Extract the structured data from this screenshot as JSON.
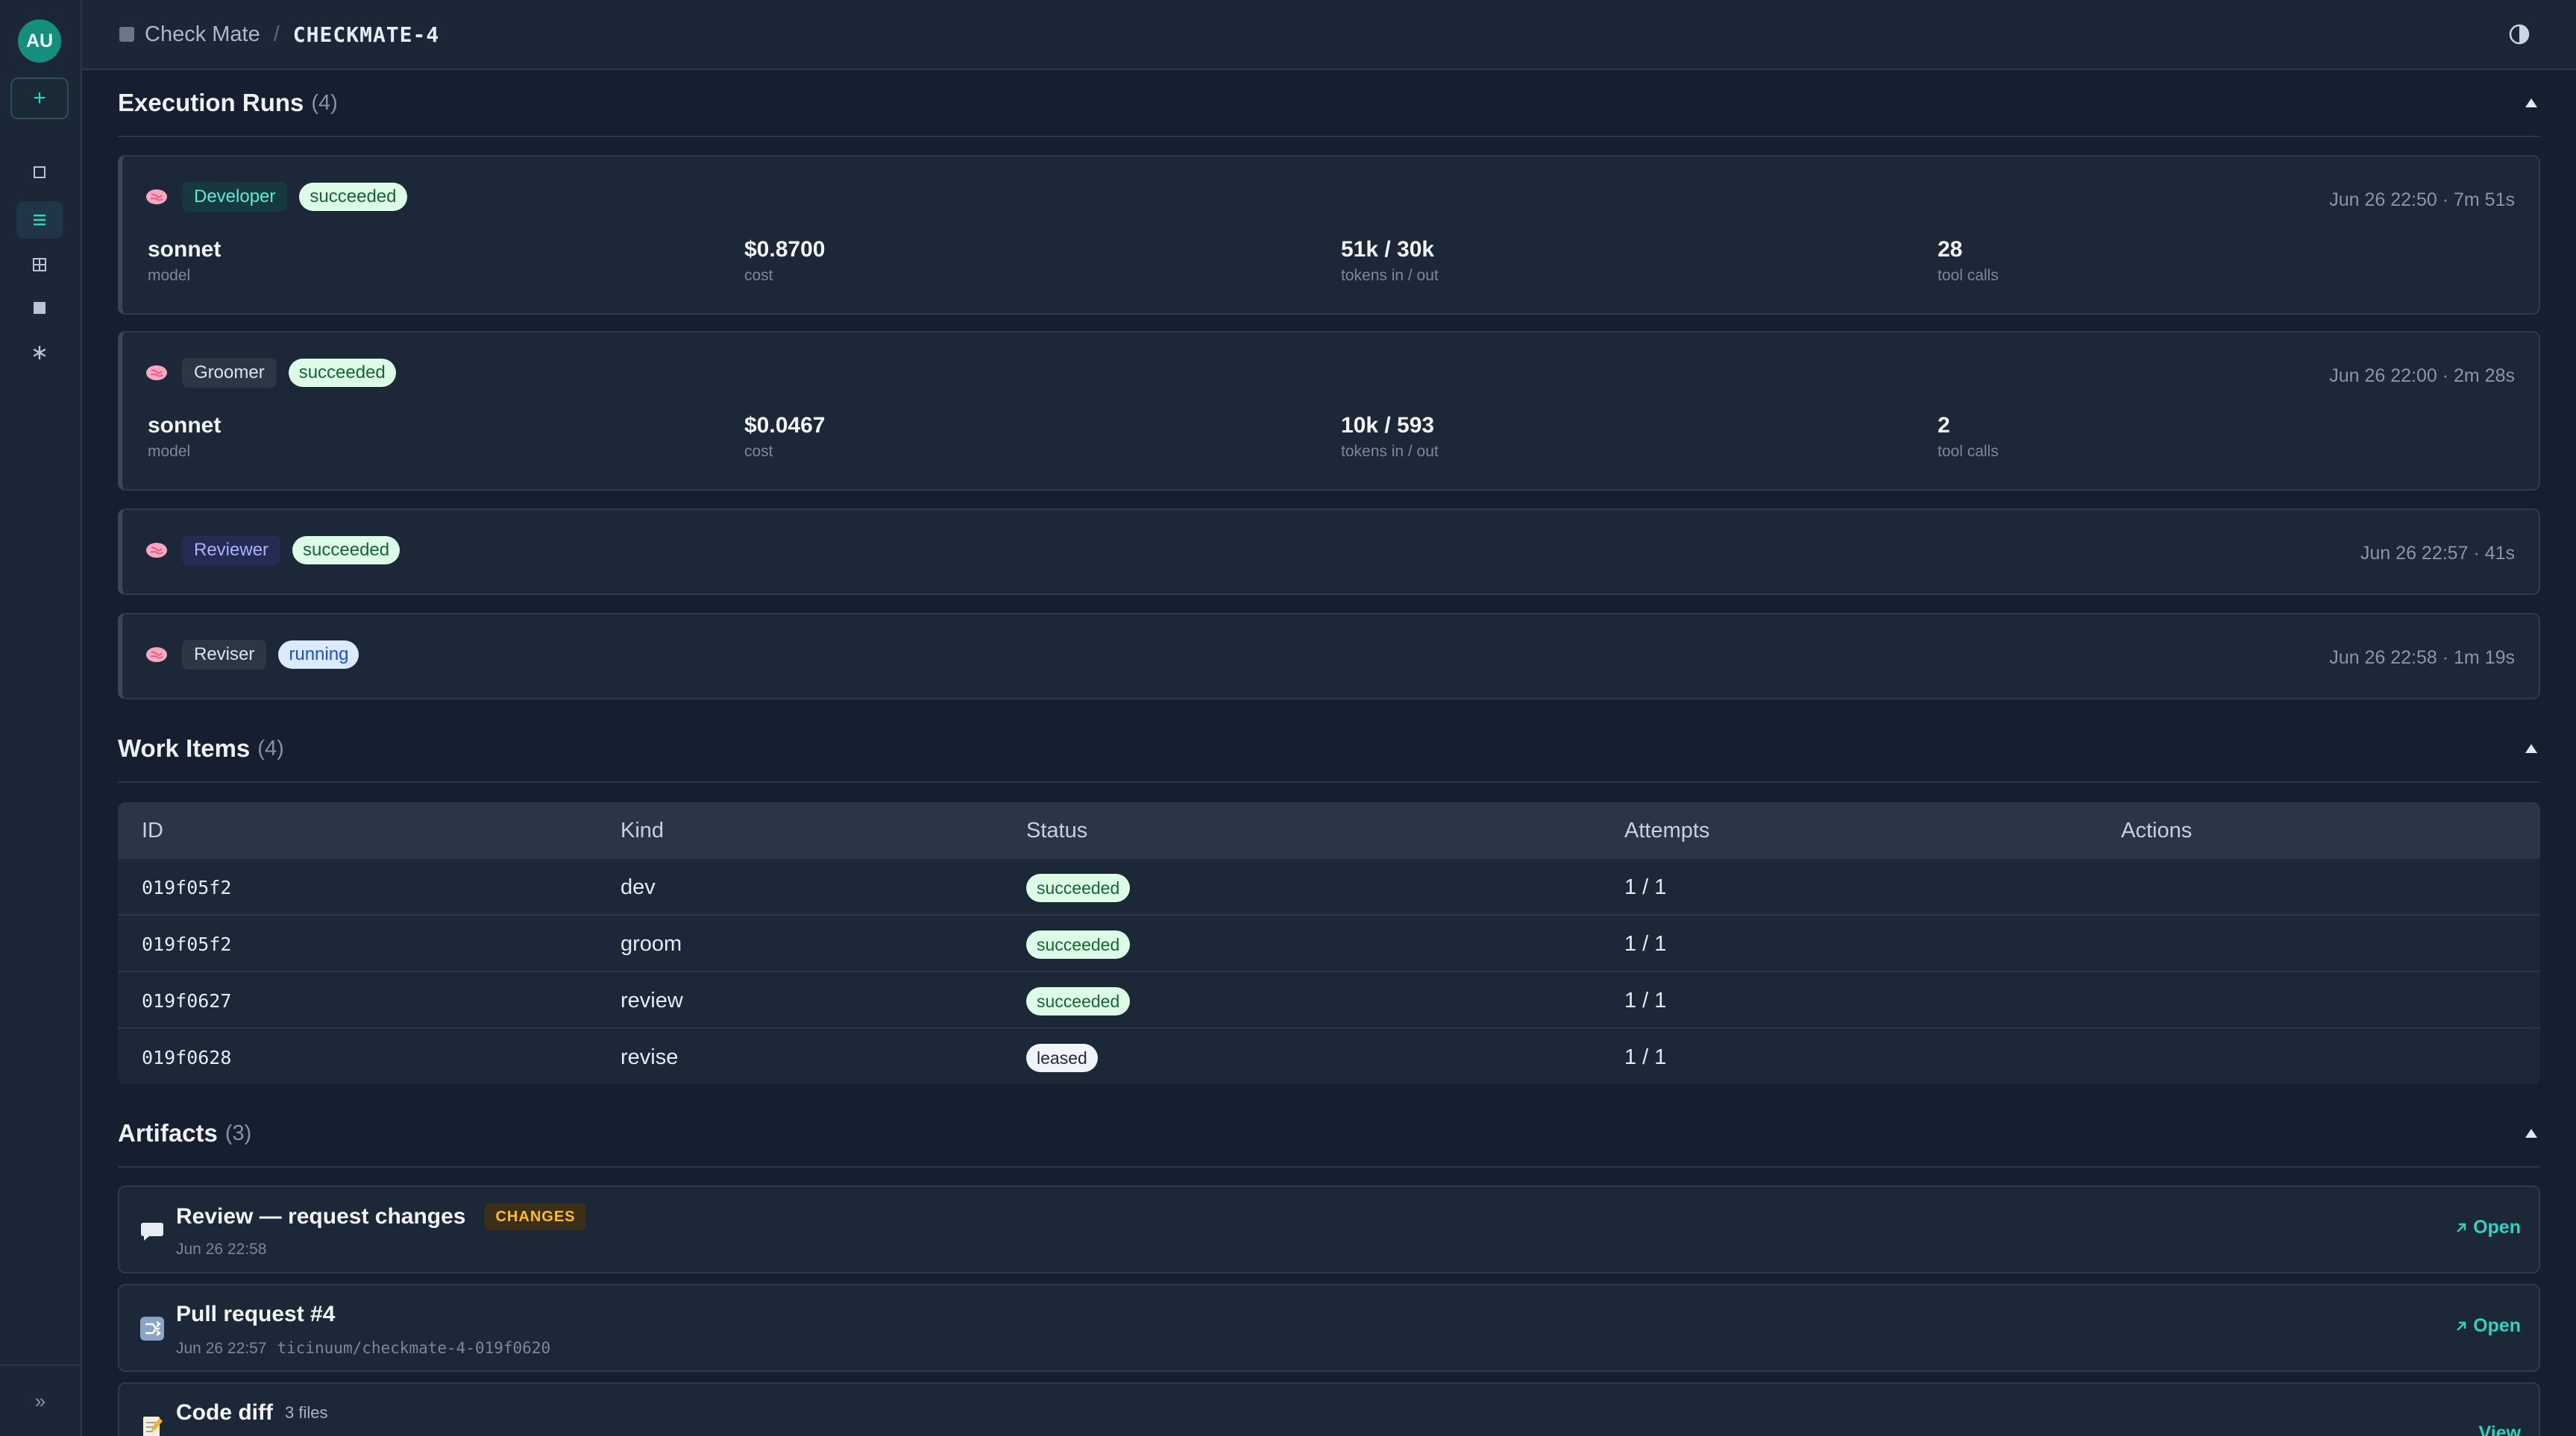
{
  "user": {
    "initials": "AU"
  },
  "sidebar": {
    "new_label": "+",
    "items": [
      {
        "name": "square-outline-icon"
      },
      {
        "name": "list-icon",
        "active": true
      },
      {
        "name": "grid-icon"
      },
      {
        "name": "square-filled-icon"
      },
      {
        "name": "asterisk-icon"
      }
    ],
    "expand_label": "»"
  },
  "breadcrumb": {
    "root": "Check Mate",
    "separator": "/",
    "current": "CHECKMATE-4"
  },
  "execution_runs": {
    "title": "Execution Runs",
    "count": "(4)",
    "runs": [
      {
        "role": "Developer",
        "status": "succeeded",
        "meta": "Jun 26 22:50 · 7m 51s",
        "stats": [
          {
            "value": "sonnet",
            "label": "model"
          },
          {
            "value": "$0.8700",
            "label": "cost"
          },
          {
            "value": "51k / 30k",
            "label": "tokens in / out"
          },
          {
            "value": "28",
            "label": "tool calls"
          }
        ]
      },
      {
        "role": "Groomer",
        "status": "succeeded",
        "meta": "Jun 26 22:00 · 2m 28s",
        "stats": [
          {
            "value": "sonnet",
            "label": "model"
          },
          {
            "value": "$0.0467",
            "label": "cost"
          },
          {
            "value": "10k / 593",
            "label": "tokens in / out"
          },
          {
            "value": "2",
            "label": "tool calls"
          }
        ]
      },
      {
        "role": "Reviewer",
        "status": "succeeded",
        "meta": "Jun 26 22:57 · 41s"
      },
      {
        "role": "Reviser",
        "status": "running",
        "meta": "Jun 26 22:58 · 1m 19s"
      }
    ]
  },
  "work_items": {
    "title": "Work Items",
    "count": "(4)",
    "columns": [
      "ID",
      "Kind",
      "Status",
      "Attempts",
      "Actions"
    ],
    "rows": [
      {
        "id": "019f05f2",
        "kind": "dev",
        "status": "succeeded",
        "attempts": "1 / 1"
      },
      {
        "id": "019f05f2",
        "kind": "groom",
        "status": "succeeded",
        "attempts": "1 / 1"
      },
      {
        "id": "019f0627",
        "kind": "review",
        "status": "succeeded",
        "attempts": "1 / 1"
      },
      {
        "id": "019f0628",
        "kind": "revise",
        "status": "leased",
        "attempts": "1 / 1"
      }
    ]
  },
  "artifacts": {
    "title": "Artifacts",
    "count": "(3)",
    "items": [
      {
        "title": "Review — request changes",
        "badge": "CHANGES",
        "date": "Jun 26 22:58",
        "action": "Open"
      },
      {
        "title": "Pull request #4",
        "date": "Jun 26 22:57",
        "ref": "ticinuum/checkmate-4-019f0620",
        "action": "Open"
      },
      {
        "title": "Code diff",
        "files": "3 files",
        "action": "View"
      }
    ]
  },
  "colors": {
    "accent": "#2dd4bf",
    "background": "#151f30",
    "card": "#1c2737"
  }
}
